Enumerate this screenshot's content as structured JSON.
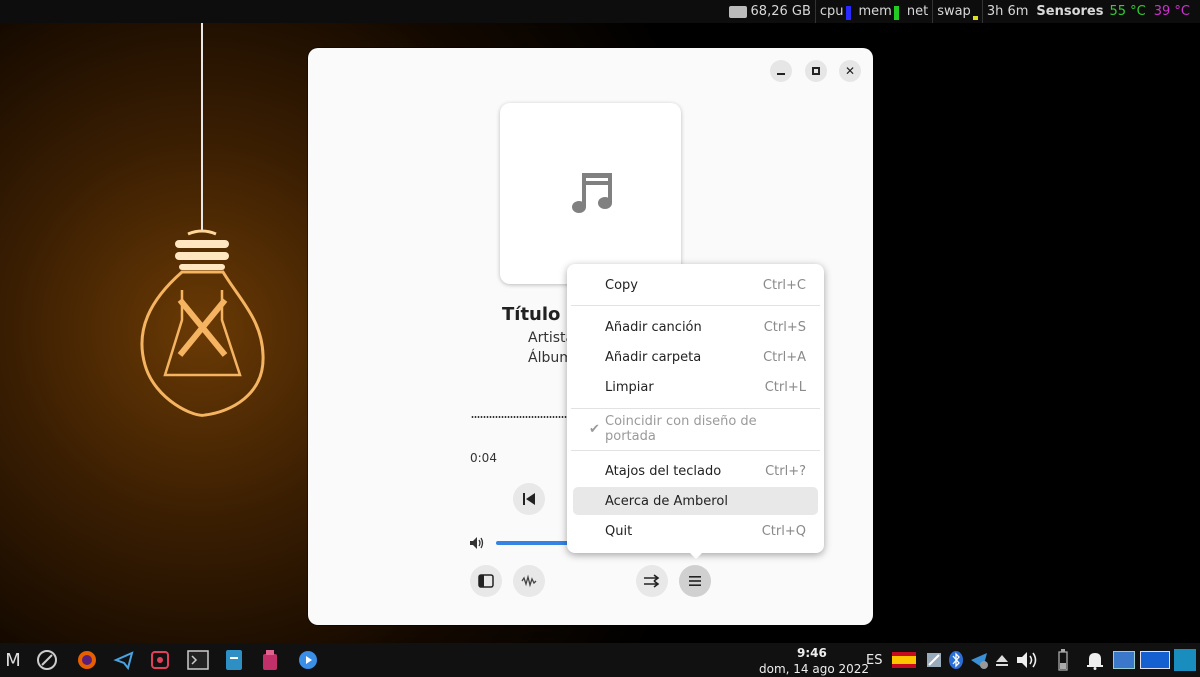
{
  "top_panel": {
    "disk": "68,26 GB",
    "cpu": "cpu",
    "mem": "mem",
    "net": "net",
    "swap": "swap",
    "uptime": "3h 6m",
    "sensors_label": "Sensores",
    "temp1": "55 °C",
    "temp2": "39 °C",
    "colors": {
      "temp1": "#33cc33",
      "temp2": "#cc33cc",
      "cpu_bar": "#2a2aff",
      "mem_bar": "#22cc22",
      "swap_bar": "#dddd22"
    }
  },
  "window": {
    "controls": [
      "minimize-icon",
      "maximize-icon",
      "close-icon"
    ],
    "song": {
      "title": "Título d",
      "artist": "Artista",
      "album": "Álbum"
    },
    "time_elapsed": "0:04",
    "accent": "#3584e4"
  },
  "menu": {
    "items": [
      {
        "label": "Copy",
        "accel": "Ctrl+C"
      },
      {
        "label": "Añadir canción",
        "accel": "Ctrl+S"
      },
      {
        "label": "Añadir carpeta",
        "accel": "Ctrl+A"
      },
      {
        "label": "Limpiar",
        "accel": "Ctrl+L"
      },
      {
        "label": "Coincidir con diseño de portada",
        "accel": "",
        "checked": true,
        "disabled": true
      },
      {
        "label": "Atajos del teclado",
        "accel": "Ctrl+?"
      },
      {
        "label": "Acerca de Amberol",
        "accel": "",
        "hover": true
      },
      {
        "label": "Quit",
        "accel": "Ctrl+Q"
      }
    ]
  },
  "taskbar": {
    "clock_time": "9:46",
    "clock_date": "dom, 14 ago 2022",
    "language": "ES"
  }
}
